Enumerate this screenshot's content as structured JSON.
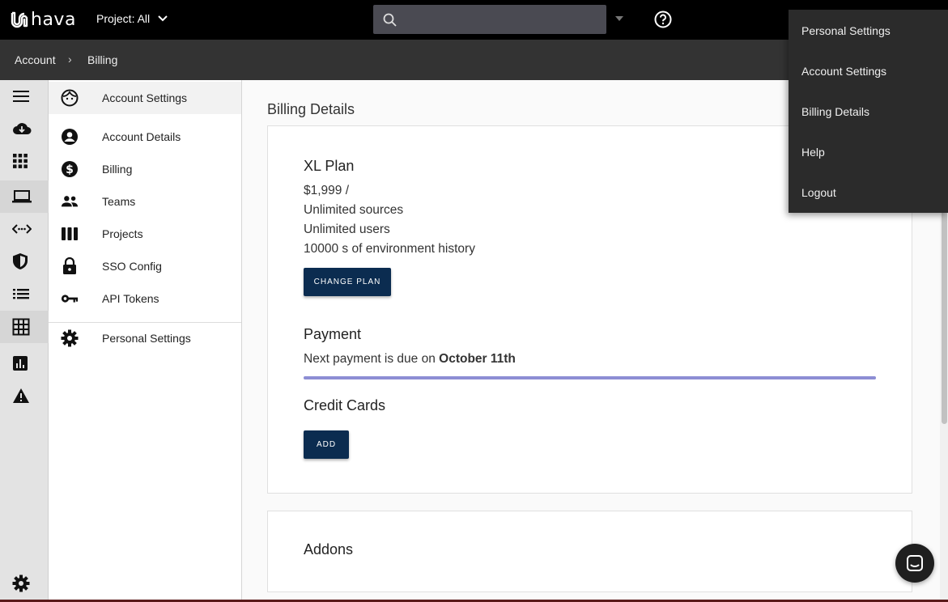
{
  "app": {
    "logo_text": "hava"
  },
  "topbar": {
    "project_selector": "Project: All",
    "search": {
      "value": "",
      "placeholder": ""
    }
  },
  "breadcrumb": {
    "items": [
      "Account",
      "Billing"
    ],
    "separator": "›"
  },
  "rail": {
    "icons": [
      "menu-icon",
      "cloud-download-icon",
      "apps-grid-icon",
      "laptop-icon",
      "code-arrows-icon",
      "shield-icon",
      "list-icon",
      "table-grid-icon",
      "bar-chart-icon",
      "warning-icon",
      "settings-gear-icon"
    ]
  },
  "settings_menu": {
    "header": "Account Settings",
    "items": [
      {
        "label": "Account Details",
        "icon": "account-circle-icon"
      },
      {
        "label": "Billing",
        "icon": "dollar-circle-icon"
      },
      {
        "label": "Teams",
        "icon": "people-icon"
      },
      {
        "label": "Projects",
        "icon": "columns-icon"
      },
      {
        "label": "SSO Config",
        "icon": "lock-icon"
      },
      {
        "label": "API Tokens",
        "icon": "key-icon"
      }
    ],
    "footer": "Personal Settings"
  },
  "billing": {
    "title": "Billing Details",
    "plan": {
      "name": "XL Plan",
      "price": "$1,999 /",
      "sources": "Unlimited sources",
      "users": "Unlimited users",
      "history": "10000 s of environment history",
      "change_button": "CHANGE PLAN"
    },
    "payment": {
      "title": "Payment",
      "due_prefix": "Next payment is due on ",
      "due_date": "October 11th",
      "progress": 1.0
    },
    "credit_cards": {
      "title": "Credit Cards",
      "add_button": "ADD"
    },
    "addons": {
      "title": "Addons"
    }
  },
  "user_menu": {
    "items": [
      "Personal Settings",
      "Account Settings",
      "Billing Details",
      "Help",
      "Logout"
    ]
  },
  "colors": {
    "topbar": "#000000",
    "breadcrumb_bar": "#333333",
    "button": "#0b2c50",
    "progress": "#8d8ed4",
    "dropdown": "#2b2b2b"
  }
}
